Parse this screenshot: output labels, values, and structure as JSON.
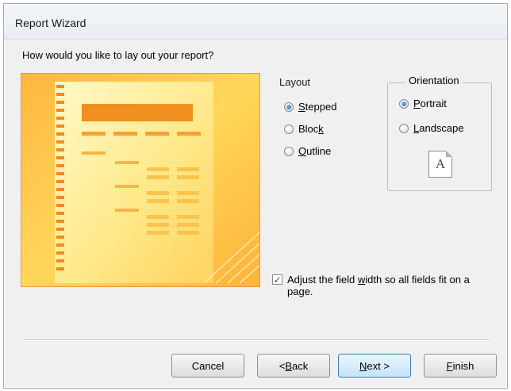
{
  "window": {
    "title": "Report Wizard"
  },
  "prompt": "How would you like to lay out your report?",
  "layout": {
    "label": "Layout",
    "options": [
      {
        "pre": "",
        "key": "S",
        "post": "tepped",
        "selected": true
      },
      {
        "pre": "Bloc",
        "key": "k",
        "post": "",
        "selected": false
      },
      {
        "pre": "",
        "key": "O",
        "post": "utline",
        "selected": false
      }
    ]
  },
  "orientation": {
    "label": "Orientation",
    "options": [
      {
        "pre": "",
        "key": "P",
        "post": "ortrait",
        "selected": true
      },
      {
        "pre": "",
        "key": "L",
        "post": "andscape",
        "selected": false
      }
    ],
    "page_glyph": "A"
  },
  "adjust_width": {
    "checked": true,
    "check_glyph": "✓",
    "label_pre": "Adjust the field ",
    "label_key": "w",
    "label_post": "idth so all fields fit on a page."
  },
  "buttons": {
    "cancel": "Cancel",
    "back_pre": "< ",
    "back_key": "B",
    "back_post": "ack",
    "next_key": "N",
    "next_post": "ext >",
    "finish_key": "F",
    "finish_post": "inish"
  },
  "colors": {
    "preview_border": "#e39b54",
    "preview_bg": "#fff7c8",
    "preview_orange": "#f3a23a",
    "preview_bar": "#ef8f1f"
  }
}
